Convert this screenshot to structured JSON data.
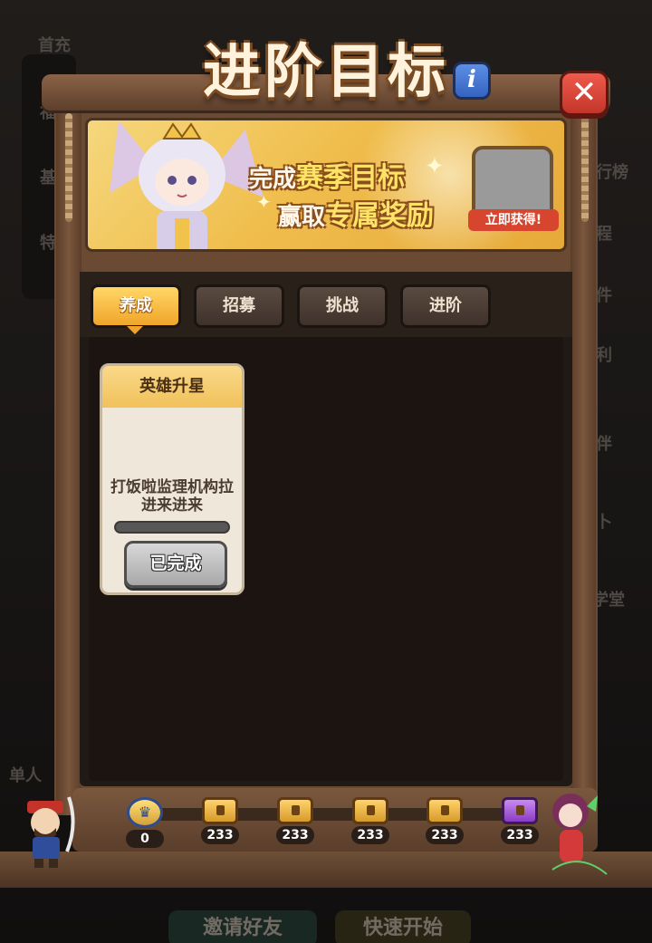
{
  "title": "进阶目标",
  "banner": {
    "line1_prefix": "完成",
    "line1_highlight": "赛季目标",
    "line2_prefix": "赢取",
    "line2_highlight": "专属奖励",
    "reward_button": "立即获得!"
  },
  "tabs": [
    {
      "label": "养成",
      "active": true
    },
    {
      "label": "招募",
      "active": false
    },
    {
      "label": "挑战",
      "active": false
    },
    {
      "label": "进阶",
      "active": false
    }
  ],
  "card": {
    "title": "英雄升星",
    "description": "打饭啦监理机构拉进来进来",
    "button": "已完成",
    "progress": 0
  },
  "milestones": [
    {
      "icon": "crown-badge-icon",
      "value": "0"
    },
    {
      "icon": "chest-icon",
      "value": "233"
    },
    {
      "icon": "chest-icon",
      "value": "233"
    },
    {
      "icon": "chest-icon",
      "value": "233"
    },
    {
      "icon": "chest-icon",
      "value": "233"
    },
    {
      "icon": "purple-chest-icon",
      "value": "233"
    }
  ],
  "background": {
    "left_menu": [
      "首充",
      "福",
      "基",
      "特",
      "单人"
    ],
    "right_menu": [
      "行榜",
      "程",
      "件",
      "利",
      "伴",
      "卜",
      "学堂"
    ],
    "bottom_buttons": [
      "邀请好友",
      "快速开始"
    ]
  },
  "colors": {
    "accent": "#f0a52a",
    "close": "#c23629",
    "info": "#3563c0"
  }
}
